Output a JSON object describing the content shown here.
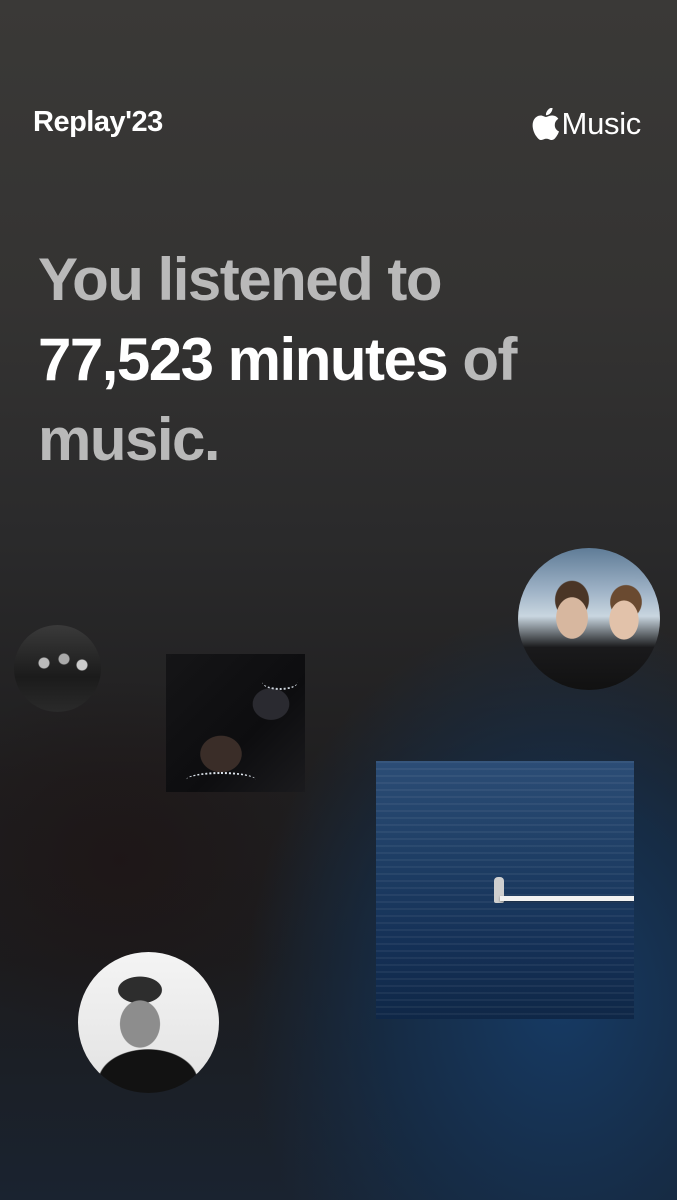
{
  "header": {
    "title": "Replay'23",
    "brand_icon": "apple-icon",
    "brand_label": "Music"
  },
  "headline": {
    "line1": "You listened to",
    "minutes": "77,523 minutes",
    "of": "of",
    "music": "music."
  },
  "artwork": [
    {
      "name": "artist-photo-duo",
      "shape": "circle"
    },
    {
      "name": "artist-photo-band",
      "shape": "circle"
    },
    {
      "name": "album-art-dark",
      "shape": "square"
    },
    {
      "name": "album-art-ocean",
      "shape": "square"
    },
    {
      "name": "artist-photo-portrait",
      "shape": "circle"
    }
  ],
  "colors": {
    "accent_dim": "#b9b9b9",
    "text": "#ffffff",
    "background_top": "#3a3937",
    "background_blue": "#163c68"
  }
}
